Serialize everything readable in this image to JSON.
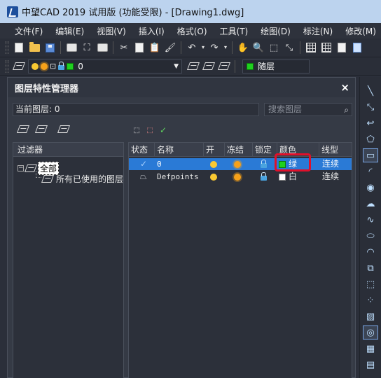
{
  "window": {
    "title": "中望CAD 2019 试用版 (功能受限) - [Drawing1.dwg]"
  },
  "menu": [
    "文件(F)",
    "编辑(E)",
    "视图(V)",
    "插入(I)",
    "格式(O)",
    "工具(T)",
    "绘图(D)",
    "标注(N)",
    "修改(M)"
  ],
  "layer_combo": {
    "value": "0"
  },
  "color_combo": {
    "value": "随层"
  },
  "palette": {
    "title": "图层特性管理器",
    "close": "×",
    "current_layer": "当前图层: 0",
    "search_placeholder": "搜索图层",
    "filter_header": "过滤器",
    "tree": {
      "root": "全部",
      "child": "所有已使用的图层"
    },
    "columns": [
      "状态",
      "名称",
      "开",
      "冻结",
      "锁定",
      "颜色",
      "线型"
    ],
    "layers": [
      {
        "status": "✓",
        "name": "0",
        "color_label": "绿",
        "color": "#1fd11f",
        "linetype": "连续",
        "selected": true
      },
      {
        "status": "",
        "name": "Defpoints",
        "color_label": "白",
        "color": "#ffffff",
        "linetype": "连续",
        "selected": false
      }
    ]
  },
  "colors": {
    "accent": "#2a7ad6",
    "annotation": "#e0102a"
  }
}
